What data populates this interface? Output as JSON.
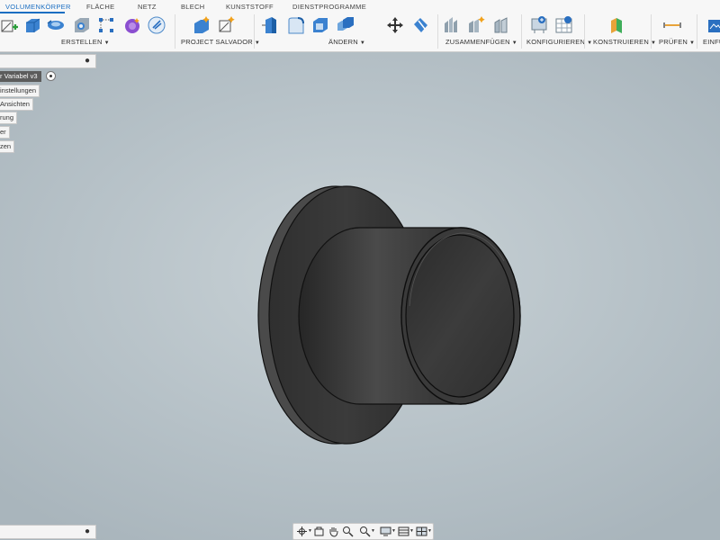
{
  "tabs": [
    "VOLUMENKÖRPER",
    "FLÄCHE",
    "NETZ",
    "BLECH",
    "KUNSTSTOFF",
    "DIENSTPROGRAMME"
  ],
  "groups": {
    "create": "ERSTELLEN",
    "salvador": "PROJECT SALVADOR",
    "modify": "ÄNDERN",
    "assemble": "ZUSAMMENFÜGEN",
    "configure": "KONFIGURIEREN",
    "construct": "KONSTRUIEREN",
    "inspect": "PRÜFEN",
    "insert": "EINFÜ"
  },
  "browser": {
    "document_name": "r Variabel v3",
    "items": [
      "instellungen",
      "Ansichten",
      "rung",
      "er",
      "zen"
    ]
  },
  "icons": {
    "create": [
      "sketch-icon",
      "extrude-icon",
      "revolve-icon",
      "hole-icon",
      "pattern-icon",
      "form-icon",
      "design-icon"
    ],
    "salvador": [
      "salvador-generate-icon",
      "salvador-sketch-icon"
    ],
    "modify": [
      "press-pull-icon",
      "fillet-icon",
      "shell-icon",
      "combine-icon",
      "move-icon",
      "split-icon"
    ],
    "assemble": [
      "joint-icon",
      "assemble-new-icon",
      "rigid-group-icon"
    ],
    "configure": [
      "configure-icon",
      "configure-table-icon"
    ],
    "construct": [
      "plane-icon"
    ],
    "inspect": [
      "measure-icon"
    ],
    "insert": [
      "insert-icon"
    ]
  },
  "colors": {
    "accent": "#1b6ec2",
    "viewport": "#b4bfc5",
    "model": "#3a3a3a"
  }
}
